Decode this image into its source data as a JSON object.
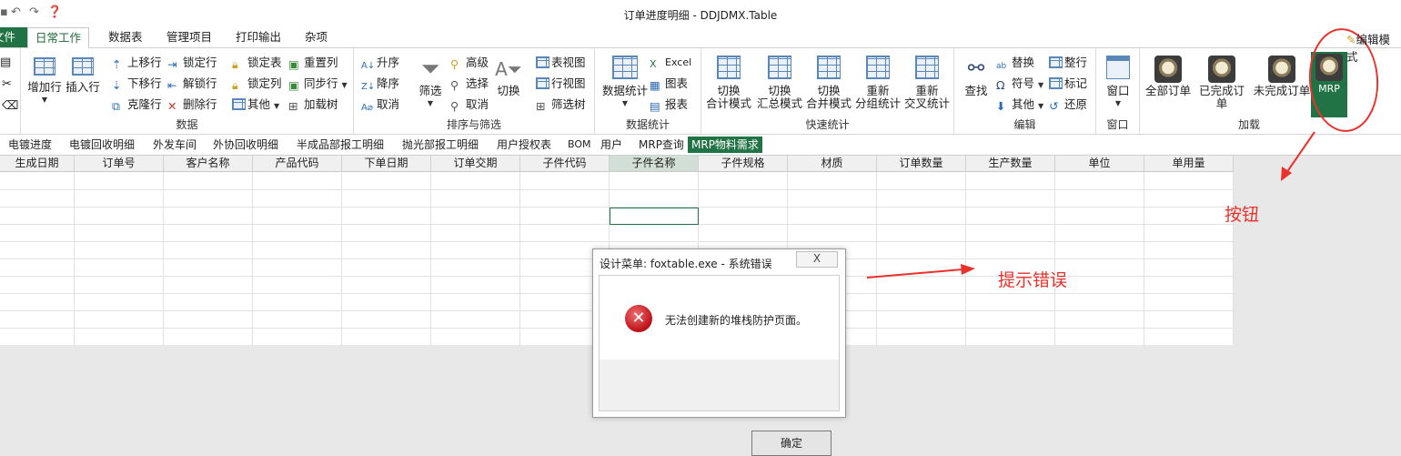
{
  "window": {
    "title": "订单进度明细 - DDJDMX.Table",
    "edit_mode_label": "编辑模式"
  },
  "ribbon_tabs": {
    "file": "文件",
    "items": [
      "日常工作",
      "数据表",
      "管理项目",
      "打印输出",
      "杂项"
    ],
    "active": "日常工作"
  },
  "ribbon": {
    "data_group": {
      "label": "数据",
      "add_row": "增加行",
      "insert_row": "插入行",
      "move_up": "上移行",
      "move_down": "下移行",
      "clone_row": "克隆行",
      "lock_row": "锁定行",
      "unlock_row": "解锁行",
      "delete_row": "删除行",
      "lock_table": "锁定表",
      "lock_column": "锁定列",
      "other": "其他",
      "reset_column": "重置列",
      "sync_row": "同步行",
      "load_tree": "加载树"
    },
    "sort_group": {
      "label": "排序与筛选",
      "ascending": "升序",
      "descending": "降序",
      "cancel_sort": "取消",
      "filter": "筛选",
      "advanced": "高级",
      "select": "选择",
      "cancel_filter": "取消",
      "switch": "切换",
      "table_view": "表视图",
      "row_view": "行视图",
      "filter_tree": "筛选树"
    },
    "stats_group": {
      "label": "数据统计",
      "data_stats": "数据统计",
      "excel": "Excel",
      "chart": "图表",
      "report": "报表"
    },
    "quick_group": {
      "label": "快速统计",
      "buttons": [
        {
          "line1": "切换",
          "line2": "合计模式"
        },
        {
          "line1": "切换",
          "line2": "汇总模式"
        },
        {
          "line1": "切换",
          "line2": "合并模式"
        },
        {
          "line1": "重新",
          "line2": "分组统计"
        },
        {
          "line1": "重新",
          "line2": "交叉统计"
        }
      ]
    },
    "edit_group": {
      "label": "编辑",
      "find": "查找",
      "replace": "替换",
      "symbol": "符号",
      "other": "其他",
      "arrange_row": "整行",
      "mark": "标记",
      "restore": "还原"
    },
    "window_group": {
      "label": "窗口",
      "window": "窗口"
    },
    "load_group": {
      "label": "加载",
      "all_orders": "全部订单",
      "completed_orders": "已完成订单",
      "incomplete_orders": "未完成订单",
      "mrp": "MRP"
    }
  },
  "sheet_tabs": {
    "items": [
      "电镀进度",
      "电镀回收明细",
      "外发车间",
      "外协回收明细",
      "半成品部报工明细",
      "抛光部报工明细",
      "用户授权表",
      "BOM",
      "用户",
      "MRP查询",
      "MRP物料需求"
    ],
    "active": "MRP物料需求"
  },
  "table": {
    "columns": [
      "生成日期",
      "订单号",
      "客户名称",
      "产品代码",
      "下单日期",
      "订单交期",
      "子件代码",
      "子件名称",
      "子件规格",
      "材质",
      "订单数量",
      "生产数量",
      "单位",
      "单用量"
    ],
    "selected_column": "子件名称"
  },
  "dialog": {
    "title": "设计菜单: foxtable.exe - 系统错误",
    "close": "X",
    "message": "无法创建新的堆栈防护页面。",
    "ok": "确定"
  },
  "annotations": {
    "button_label": "按钮",
    "error_label": "提示错误",
    "color": "#e8322b"
  }
}
